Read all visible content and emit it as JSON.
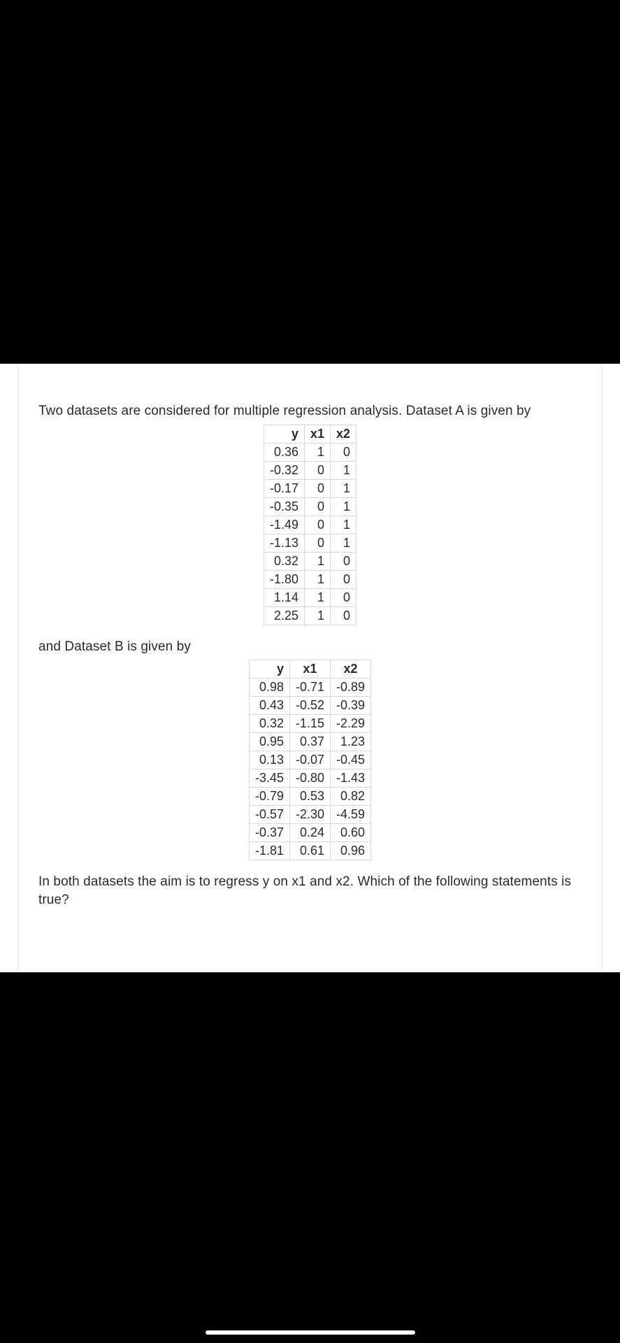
{
  "text": {
    "intro": "Two datasets are considered for multiple regression analysis. Dataset A is given by",
    "mid": "and Dataset B is given by",
    "outro": "In both datasets the aim is to regress y on x1 and x2. Which of the following statements is true?"
  },
  "tableA": {
    "headers": [
      "y",
      "x1",
      "x2"
    ],
    "rows": [
      [
        "0.36",
        "1",
        "0"
      ],
      [
        "-0.32",
        "0",
        "1"
      ],
      [
        "-0.17",
        "0",
        "1"
      ],
      [
        "-0.35",
        "0",
        "1"
      ],
      [
        "-1.49",
        "0",
        "1"
      ],
      [
        "-1.13",
        "0",
        "1"
      ],
      [
        "0.32",
        "1",
        "0"
      ],
      [
        "-1.80",
        "1",
        "0"
      ],
      [
        "1.14",
        "1",
        "0"
      ],
      [
        "2.25",
        "1",
        "0"
      ]
    ]
  },
  "tableB": {
    "headers": [
      "y",
      "x1",
      "x2"
    ],
    "rows": [
      [
        "0.98",
        "-0.71",
        "-0.89"
      ],
      [
        "0.43",
        "-0.52",
        "-0.39"
      ],
      [
        "0.32",
        "-1.15",
        "-2.29"
      ],
      [
        "0.95",
        "0.37",
        "1.23"
      ],
      [
        "0.13",
        "-0.07",
        "-0.45"
      ],
      [
        "-3.45",
        "-0.80",
        "-1.43"
      ],
      [
        "-0.79",
        "0.53",
        "0.82"
      ],
      [
        "-0.57",
        "-2.30",
        "-4.59"
      ],
      [
        "-0.37",
        "0.24",
        "0.60"
      ],
      [
        "-1.81",
        "0.61",
        "0.96"
      ]
    ]
  }
}
